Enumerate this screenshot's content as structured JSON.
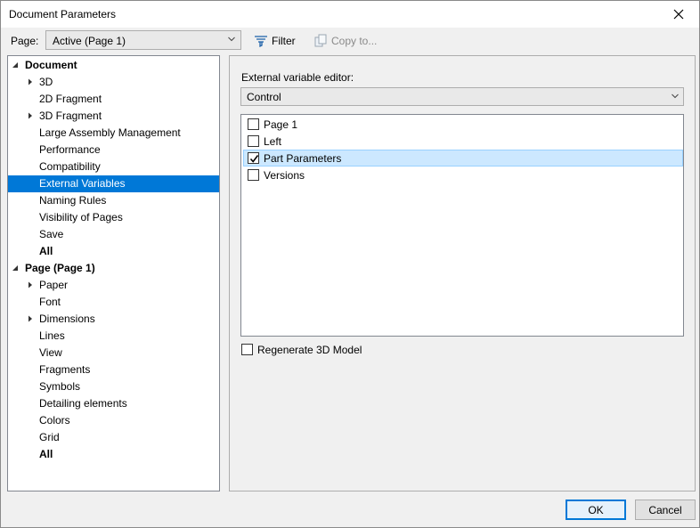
{
  "window": {
    "title": "Document Parameters"
  },
  "toolbar": {
    "page_label": "Page:",
    "page_select_value": "Active (Page 1)",
    "filter_label": "Filter",
    "copy_label": "Copy to..."
  },
  "tree": {
    "items": [
      {
        "label": "Document",
        "bold": true,
        "arrow": "expanded",
        "level": 0
      },
      {
        "label": "3D",
        "bold": false,
        "arrow": "collapsed",
        "level": 1
      },
      {
        "label": "2D Fragment",
        "bold": false,
        "arrow": "",
        "level": 1
      },
      {
        "label": "3D Fragment",
        "bold": false,
        "arrow": "collapsed",
        "level": 1
      },
      {
        "label": "Large Assembly Management",
        "bold": false,
        "arrow": "",
        "level": 1
      },
      {
        "label": "Performance",
        "bold": false,
        "arrow": "",
        "level": 1
      },
      {
        "label": "Compatibility",
        "bold": false,
        "arrow": "",
        "level": 1
      },
      {
        "label": "External Variables",
        "bold": false,
        "arrow": "",
        "level": 1,
        "selected": true
      },
      {
        "label": "Naming Rules",
        "bold": false,
        "arrow": "",
        "level": 1
      },
      {
        "label": "Visibility of Pages",
        "bold": false,
        "arrow": "",
        "level": 1
      },
      {
        "label": "Save",
        "bold": false,
        "arrow": "",
        "level": 1
      },
      {
        "label": "All",
        "bold": true,
        "arrow": "",
        "level": 1
      },
      {
        "label": "Page (Page 1)",
        "bold": true,
        "arrow": "expanded",
        "level": 0
      },
      {
        "label": "Paper",
        "bold": false,
        "arrow": "collapsed",
        "level": 1
      },
      {
        "label": "Font",
        "bold": false,
        "arrow": "",
        "level": 1
      },
      {
        "label": "Dimensions",
        "bold": false,
        "arrow": "collapsed",
        "level": 1
      },
      {
        "label": "Lines",
        "bold": false,
        "arrow": "",
        "level": 1
      },
      {
        "label": "View",
        "bold": false,
        "arrow": "",
        "level": 1
      },
      {
        "label": "Fragments",
        "bold": false,
        "arrow": "",
        "level": 1
      },
      {
        "label": "Symbols",
        "bold": false,
        "arrow": "",
        "level": 1
      },
      {
        "label": "Detailing elements",
        "bold": false,
        "arrow": "",
        "level": 1
      },
      {
        "label": "Colors",
        "bold": false,
        "arrow": "",
        "level": 1
      },
      {
        "label": "Grid",
        "bold": false,
        "arrow": "",
        "level": 1
      },
      {
        "label": "All",
        "bold": true,
        "arrow": "",
        "level": 1
      }
    ]
  },
  "panel": {
    "editor_label": "External variable editor:",
    "editor_value": "Control",
    "list_items": [
      {
        "label": "Page 1",
        "checked": false,
        "selected": false
      },
      {
        "label": "Left",
        "checked": false,
        "selected": false
      },
      {
        "label": "Part Parameters",
        "checked": true,
        "selected": true
      },
      {
        "label": "Versions",
        "checked": false,
        "selected": false
      }
    ],
    "regenerate_label": "Regenerate 3D Model",
    "regenerate_checked": false
  },
  "buttons": {
    "ok": "OK",
    "cancel": "Cancel"
  },
  "colors": {
    "selection": "#0078d7",
    "list_selection": "#cce8ff",
    "default_button_border": "#0078d7"
  }
}
